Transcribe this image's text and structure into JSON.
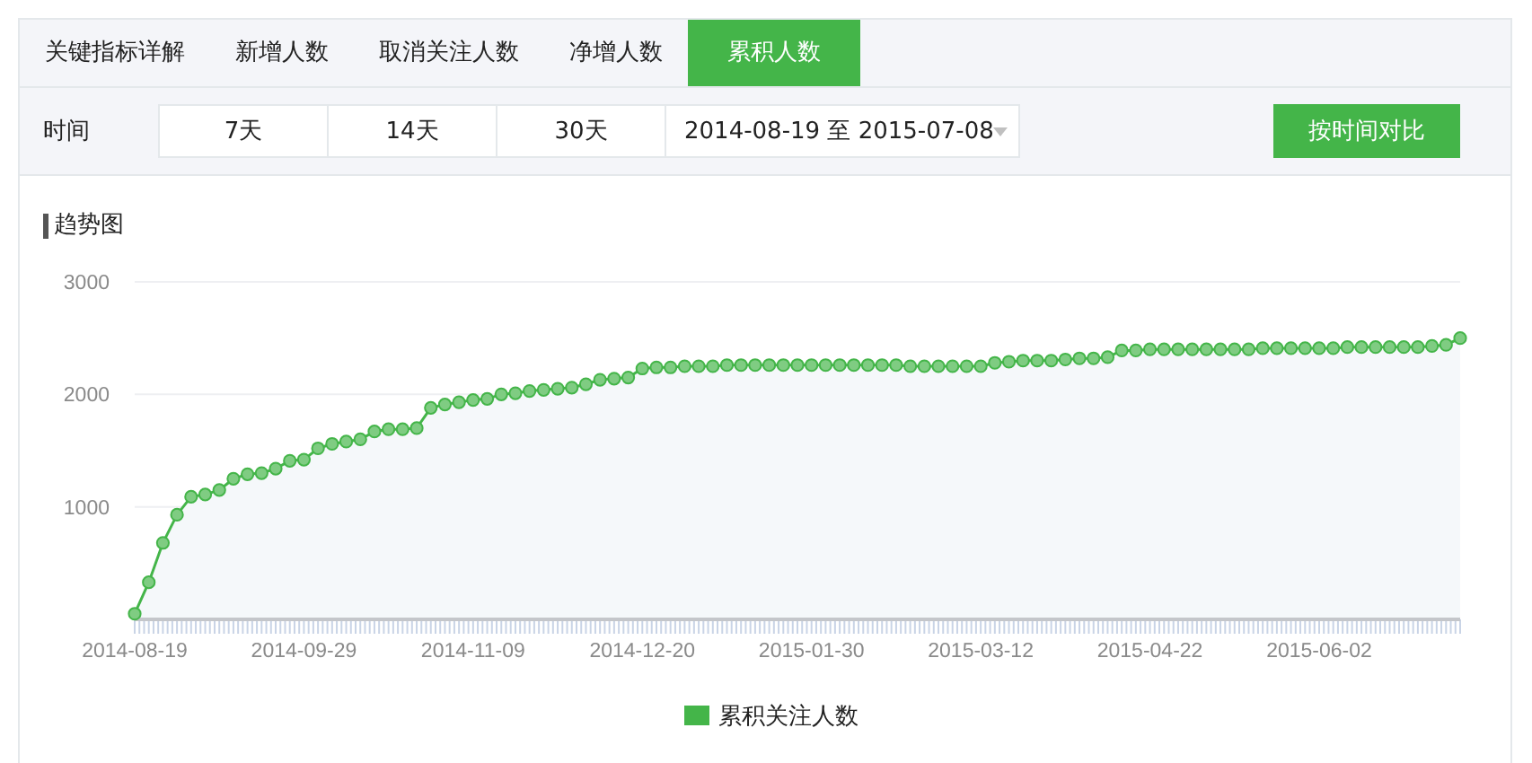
{
  "tabs": [
    {
      "label": "关键指标详解",
      "selected": false
    },
    {
      "label": "新增人数",
      "selected": false
    },
    {
      "label": "取消关注人数",
      "selected": false
    },
    {
      "label": "净增人数",
      "selected": false
    },
    {
      "label": "累积人数",
      "selected": true
    }
  ],
  "filter": {
    "label": "时间",
    "ranges": [
      {
        "label": "7天",
        "selected": false
      },
      {
        "label": "14天",
        "selected": false
      },
      {
        "label": "30天",
        "selected": false
      }
    ],
    "date_range": "2014-08-19 至 2015-07-08",
    "compare_button": "按时间对比"
  },
  "chart": {
    "title": "趋势图",
    "chart_data": {
      "type": "area",
      "ylim": [
        0,
        3000
      ],
      "yticks": [
        1000,
        2000,
        3000
      ],
      "categories": [
        "2014-08-19",
        null,
        null,
        null,
        null,
        null,
        null,
        null,
        null,
        null,
        null,
        null,
        "2014-09-29",
        null,
        null,
        null,
        null,
        null,
        null,
        null,
        null,
        null,
        null,
        null,
        "2014-11-09",
        null,
        null,
        null,
        null,
        null,
        null,
        null,
        null,
        null,
        null,
        null,
        "2014-12-20",
        null,
        null,
        null,
        null,
        null,
        null,
        null,
        null,
        null,
        null,
        null,
        "2015-01-30",
        null,
        null,
        null,
        null,
        null,
        null,
        null,
        null,
        null,
        null,
        null,
        "2015-03-12",
        null,
        null,
        null,
        null,
        null,
        null,
        null,
        null,
        null,
        null,
        null,
        "2015-04-22",
        null,
        null,
        null,
        null,
        null,
        null,
        null,
        null,
        null,
        null,
        null,
        "2015-06-02",
        null,
        null,
        null,
        null,
        null,
        null,
        null,
        null,
        null,
        null
      ],
      "series": [
        {
          "name": "累积关注人数",
          "color": "#44b549",
          "marker": true,
          "values": [
            50,
            330,
            680,
            930,
            1090,
            1110,
            1150,
            1250,
            1290,
            1300,
            1340,
            1410,
            1420,
            1520,
            1560,
            1580,
            1600,
            1670,
            1690,
            1690,
            1700,
            1880,
            1910,
            1930,
            1950,
            1960,
            2000,
            2010,
            2030,
            2040,
            2050,
            2060,
            2090,
            2130,
            2140,
            2150,
            2230,
            2240,
            2240,
            2250,
            2250,
            2250,
            2260,
            2260,
            2260,
            2260,
            2260,
            2260,
            2260,
            2260,
            2260,
            2260,
            2260,
            2260,
            2260,
            2250,
            2250,
            2250,
            2250,
            2250,
            2250,
            2280,
            2290,
            2300,
            2300,
            2300,
            2310,
            2320,
            2320,
            2330,
            2390,
            2390,
            2400,
            2400,
            2400,
            2400,
            2400,
            2400,
            2400,
            2400,
            2410,
            2410,
            2410,
            2410,
            2410,
            2410,
            2420,
            2420,
            2420,
            2420,
            2420,
            2420,
            2430,
            2440,
            2500
          ]
        }
      ]
    }
  }
}
